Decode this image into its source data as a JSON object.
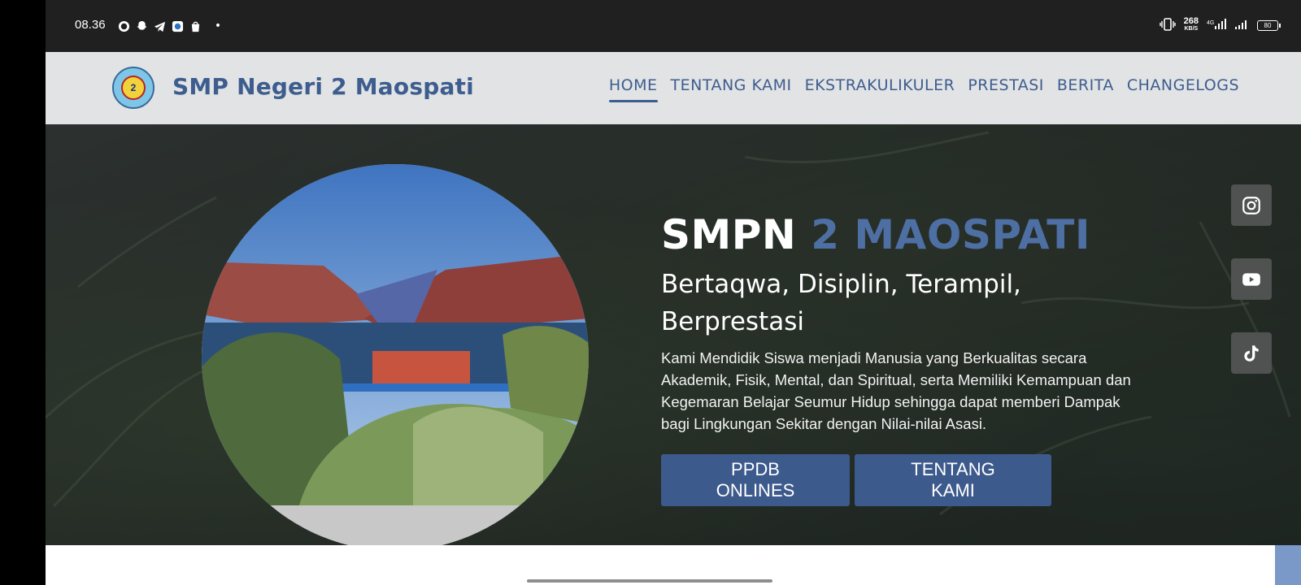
{
  "status_bar": {
    "time": "08.36",
    "apps": [
      "whatsapp-icon",
      "snapchat-icon",
      "telegram-icon",
      "app-icon",
      "shopee-icon"
    ],
    "dot": "•",
    "net_speed_value": "268",
    "net_speed_unit": "KB/S",
    "battery": "80"
  },
  "header": {
    "title": "SMP Negeri 2 Maospati",
    "nav": [
      {
        "label": "HOME",
        "active": true
      },
      {
        "label": "TENTANG KAMI",
        "active": false
      },
      {
        "label": "EKSTRAKULIKULER",
        "active": false
      },
      {
        "label": "PRESTASI",
        "active": false
      },
      {
        "label": "BERITA",
        "active": false
      },
      {
        "label": "CHANGELOGS",
        "active": false
      }
    ]
  },
  "hero": {
    "heading_main": "SMPN",
    "heading_accent": "2 MAOSPATI",
    "tagline": "Bertaqwa, Disiplin, Terampil, Berprestasi",
    "description": "Kami Mendidik Siswa menjadi Manusia yang Berkualitas secara Akademik, Fisik, Mental, dan Spiritual, serta Memiliki Kemampuan dan Kegemaran Belajar Seumur Hidup sehingga dapat memberi Dampak bagi Lingkungan Sekitar dengan Nilai-nilai Asasi.",
    "buttons": {
      "ppdb": "PPDB ONLINES",
      "tentang": "TENTANG KAMI"
    },
    "socials": [
      "instagram-icon",
      "youtube-icon",
      "tiktok-icon"
    ]
  },
  "colors": {
    "brand": "#3e5d8f",
    "button": "#3d5a8c",
    "accent_text": "#4e6fa3",
    "header_bg": "#e1e3e4",
    "status_bg": "#202020"
  }
}
